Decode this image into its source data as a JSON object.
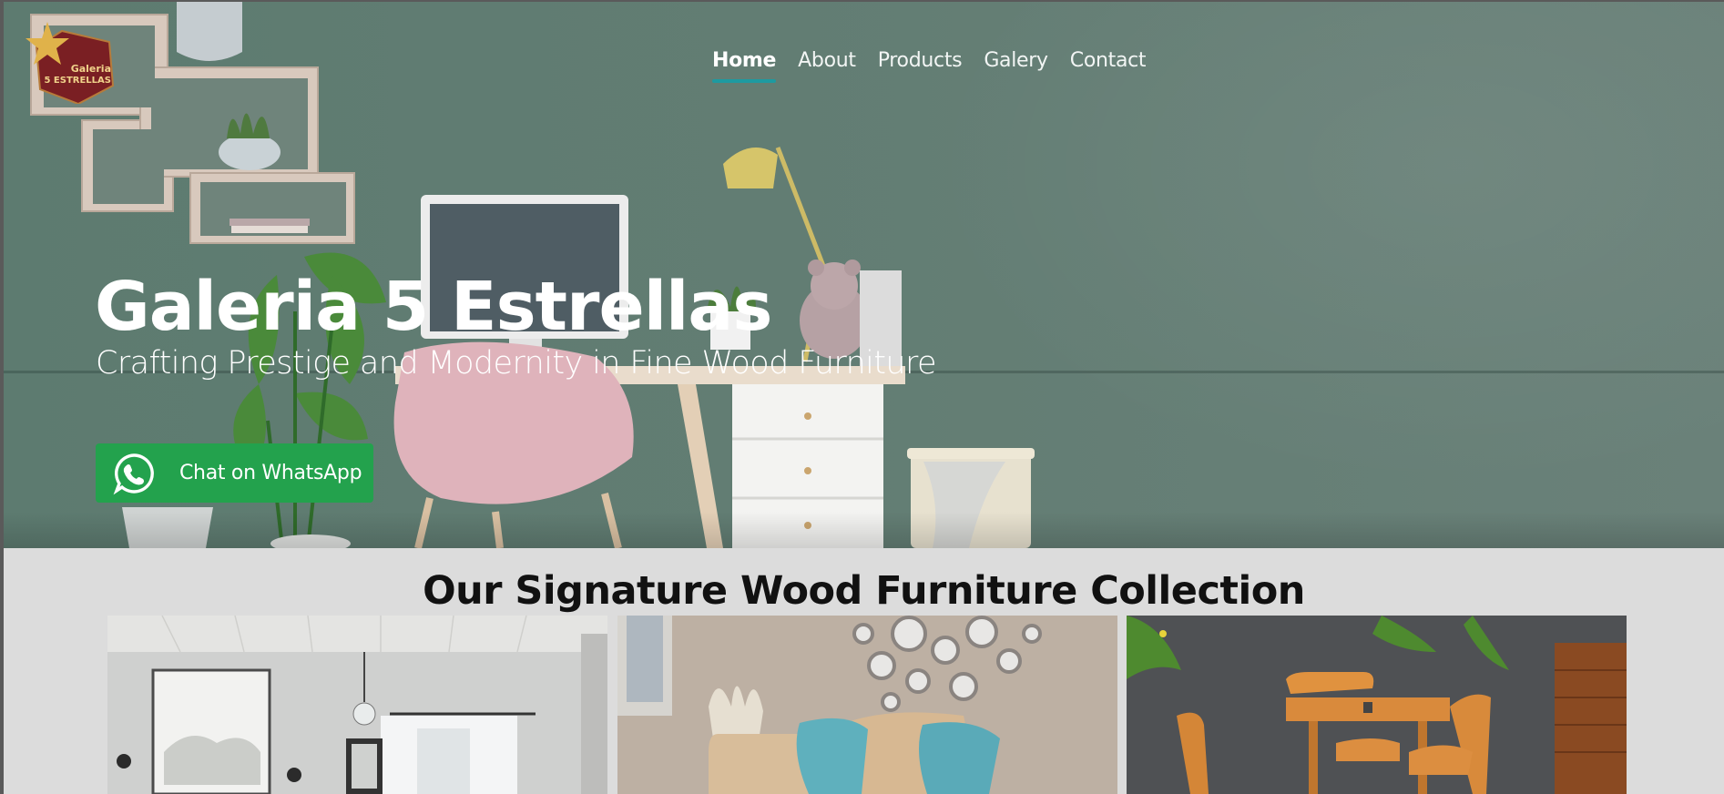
{
  "brand": {
    "logo_line1": "Galeria",
    "logo_line2": "5 ESTRELLAS"
  },
  "nav": {
    "items": [
      {
        "label": "Home",
        "active": true
      },
      {
        "label": "About",
        "active": false
      },
      {
        "label": "Products",
        "active": false
      },
      {
        "label": "Galery",
        "active": false
      },
      {
        "label": "Contact",
        "active": false
      }
    ]
  },
  "hero": {
    "title": "Galeria 5 Estrellas",
    "subtitle": "Crafting Prestige and Modernity in Fine Wood Furniture",
    "cta_label": "Chat on WhatsApp",
    "cta_icon": "whatsapp-icon"
  },
  "collection": {
    "title": "Our Signature Wood Furniture Collection",
    "cards": [
      {
        "image": "bedroom-photo"
      },
      {
        "image": "living-room-photo"
      },
      {
        "image": "patio-dining-photo"
      }
    ]
  },
  "colors": {
    "wall": "#627d73",
    "accent": "#1e9aa0",
    "whatsapp": "#23a24d",
    "section_bg": "#dcdcdc"
  }
}
